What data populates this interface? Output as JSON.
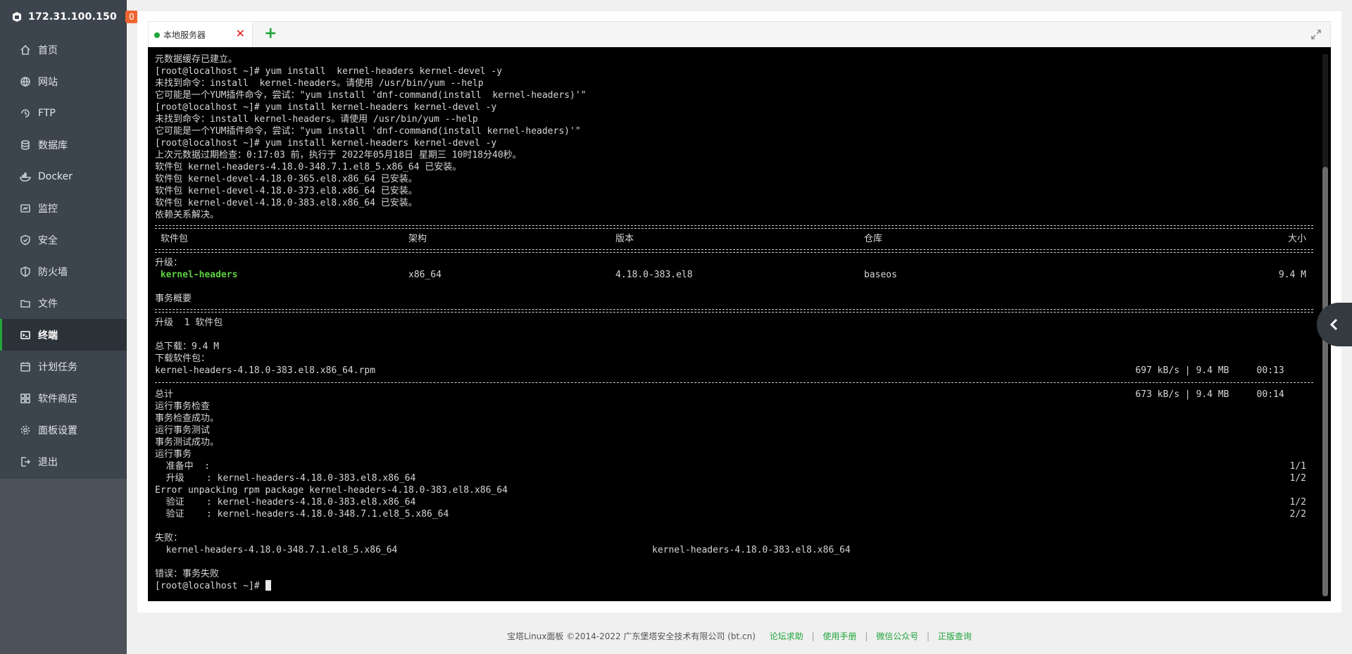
{
  "sidebar": {
    "ip": "172.31.100.150",
    "badge": "0",
    "items": [
      {
        "label": "首页",
        "icon": "home-icon"
      },
      {
        "label": "网站",
        "icon": "globe-icon"
      },
      {
        "label": "FTP",
        "icon": "ftp-icon"
      },
      {
        "label": "数据库",
        "icon": "database-icon"
      },
      {
        "label": "Docker",
        "icon": "docker-icon"
      },
      {
        "label": "监控",
        "icon": "monitor-icon"
      },
      {
        "label": "安全",
        "icon": "shield-icon"
      },
      {
        "label": "防火墙",
        "icon": "firewall-icon"
      },
      {
        "label": "文件",
        "icon": "folder-icon"
      },
      {
        "label": "终端",
        "icon": "terminal-icon"
      },
      {
        "label": "计划任务",
        "icon": "calendar-icon"
      },
      {
        "label": "软件商店",
        "icon": "grid-icon"
      },
      {
        "label": "面板设置",
        "icon": "gear-icon"
      },
      {
        "label": "退出",
        "icon": "logout-icon"
      }
    ],
    "active_index": 9
  },
  "tabs": {
    "items": [
      {
        "label": "本地服务器"
      }
    ],
    "close_symbol": "✕",
    "add_symbol": "+"
  },
  "terminal": {
    "lines": [
      {
        "t": "元数据缓存已建立。"
      },
      {
        "t": "[root@localhost ~]# yum install  kernel-headers kernel-devel -y"
      },
      {
        "t": "未找到命令：install  kernel-headers。请使用 /usr/bin/yum --help"
      },
      {
        "t": "它可能是一个YUM插件命令，尝试：\"yum install 'dnf-command(install  kernel-headers)'\""
      },
      {
        "t": "[root@localhost ~]# yum install kernel-headers kernel-devel -y"
      },
      {
        "t": "未找到命令：install kernel-headers。请使用 /usr/bin/yum --help"
      },
      {
        "t": "它可能是一个YUM插件命令，尝试：\"yum install 'dnf-command(install kernel-headers)'\""
      },
      {
        "t": "[root@localhost ~]# yum install kernel-headers kernel-devel -y"
      },
      {
        "t": "上次元数据过期检查：0:17:03 前，执行于 2022年05月18日 星期三 10时18分40秒。"
      },
      {
        "t": "软件包 kernel-headers-4.18.0-348.7.1.el8_5.x86_64 已安装。"
      },
      {
        "t": "软件包 kernel-devel-4.18.0-365.el8.x86_64 已安装。"
      },
      {
        "t": "软件包 kernel-devel-4.18.0-373.el8.x86_64 已安装。"
      },
      {
        "t": "软件包 kernel-devel-4.18.0-383.el8.x86_64 已安装。"
      },
      {
        "t": "依赖关系解决。"
      },
      {
        "rule": "double"
      },
      {
        "cols": [
          " 软件包",
          "架构",
          "版本",
          "仓库"
        ],
        "right": "大小"
      },
      {
        "rule": "double"
      },
      {
        "t": "升级："
      },
      {
        "cols": [
          " kernel-headers",
          "x86_64",
          "4.18.0-383.el8",
          "baseos"
        ],
        "right": "9.4 M",
        "green": true
      },
      {
        "t": ""
      },
      {
        "t": "事务概要"
      },
      {
        "rule": "double"
      },
      {
        "t": "升级  1 软件包"
      },
      {
        "t": ""
      },
      {
        "t": "总下载：9.4 M"
      },
      {
        "t": "下载软件包："
      },
      {
        "t": "kernel-headers-4.18.0-383.el8.x86_64.rpm",
        "right": "697 kB/s | 9.4 MB     00:13    "
      },
      {
        "rule": "single"
      },
      {
        "t": "总计",
        "right": "673 kB/s | 9.4 MB     00:14    "
      },
      {
        "t": "运行事务检查"
      },
      {
        "t": "事务检查成功。"
      },
      {
        "t": "运行事务测试"
      },
      {
        "t": "事务测试成功。"
      },
      {
        "t": "运行事务"
      },
      {
        "t": "  准备中  :",
        "right": "1/1"
      },
      {
        "t": "  升级    : kernel-headers-4.18.0-383.el8.x86_64",
        "right": "1/2"
      },
      {
        "t": "Error unpacking rpm package kernel-headers-4.18.0-383.el8.x86_64"
      },
      {
        "t": "  验证    : kernel-headers-4.18.0-383.el8.x86_64",
        "right": "1/2"
      },
      {
        "t": "  验证    : kernel-headers-4.18.0-348.7.1.el8_5.x86_64",
        "right": "2/2"
      },
      {
        "t": ""
      },
      {
        "t": "失败："
      },
      {
        "cols2": [
          "  kernel-headers-4.18.0-348.7.1.el8_5.x86_64",
          "kernel-headers-4.18.0-383.el8.x86_64"
        ]
      },
      {
        "t": ""
      },
      {
        "t": "错误：事务失败"
      },
      {
        "t": "[root@localhost ~]# ",
        "cursor": true
      }
    ]
  },
  "footer": {
    "copyright": "宝塔Linux面板 ©2014-2022 广东堡塔安全技术有限公司 (bt.cn)",
    "links": [
      "论坛求助",
      "使用手册",
      "微信公众号",
      "正版查询"
    ],
    "separator": "|"
  },
  "colors": {
    "accent": "#20a53a",
    "sidebar_bg": "#3c444d",
    "badge": "#f0652f",
    "close": "#e0161b",
    "terminal_bg": "#000000"
  }
}
